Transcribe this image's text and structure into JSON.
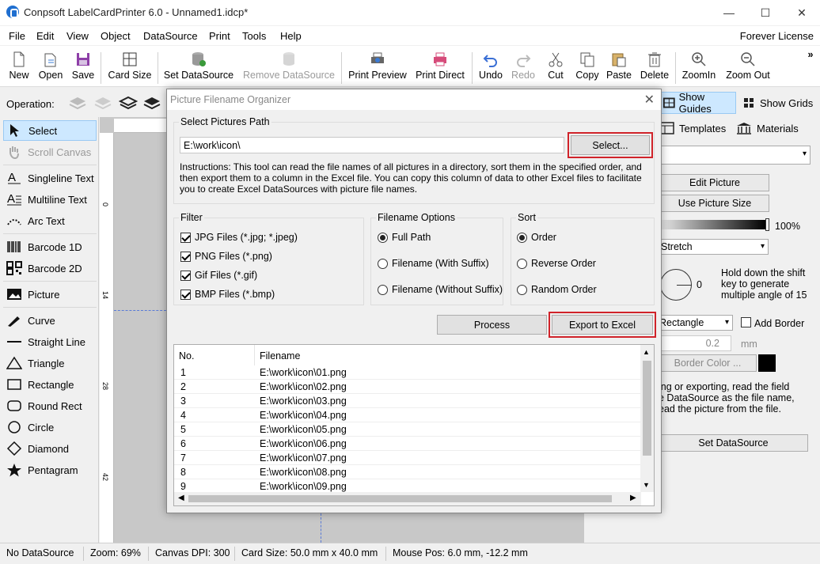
{
  "window": {
    "title": "Conpsoft LabelCardPrinter 6.0 - Unnamed1.idcp*",
    "minimize": "—",
    "maximize": "☐",
    "close": "✕"
  },
  "menu": {
    "items": [
      "File",
      "Edit",
      "View",
      "Object",
      "DataSource",
      "Print",
      "Tools",
      "Help"
    ],
    "license": "Forever License"
  },
  "toolbar": {
    "new": "New",
    "open": "Open",
    "save": "Save",
    "card_size": "Card Size",
    "set_datasource": "Set DataSource",
    "remove_datasource": "Remove DataSource",
    "print_preview": "Print Preview",
    "print_direct": "Print Direct",
    "undo": "Undo",
    "redo": "Redo",
    "cut": "Cut",
    "copy": "Copy",
    "paste": "Paste",
    "delete": "Delete",
    "zoom_in": "ZoomIn",
    "zoom_out": "Zoom Out",
    "more": "»"
  },
  "operation": {
    "label": "Operation:",
    "show_guides": "Show Guides",
    "show_grids": "Show Grids"
  },
  "left_tools": [
    "Select",
    "Scroll Canvas",
    "Singleline Text",
    "Multiline Text",
    "Arc Text",
    "Barcode 1D",
    "Barcode 2D",
    "Picture",
    "Curve",
    "Straight Line",
    "Triangle",
    "Rectangle",
    "Round Rect",
    "Circle",
    "Diamond",
    "Pentagram"
  ],
  "ruler": {
    "marks": [
      "0",
      "14",
      "28",
      "42"
    ]
  },
  "right_panel": {
    "tab_templates": "Templates",
    "tab_materials": "Materials",
    "edit_picture": "Edit Picture",
    "use_picture_size": "Use Picture Size",
    "opacity": "100%",
    "stretch": "Stretch",
    "angle_value": "0",
    "angle_hint": "Hold down the shift key to generate multiple angle of 15",
    "shape": "Rectangle",
    "add_border": "Add Border",
    "border_width": "0.2",
    "unit": "mm",
    "border_color": "Border Color ...",
    "ds_hint_1": "ing or exporting, read the field",
    "ds_hint_2": "e DataSource as the file name,",
    "ds_hint_3": "ead the picture from the file.",
    "set_datasource": "Set DataSource"
  },
  "status": {
    "ds": "No DataSource",
    "zoom": "Zoom: 69%",
    "dpi": "Canvas DPI: 300",
    "card": "Card Size: 50.0 mm x 40.0 mm",
    "mouse": "Mouse Pos: 6.0 mm, -12.2 mm"
  },
  "dialog": {
    "title": "Picture Filename Organizer",
    "path_group": "Select Pictures Path",
    "path_value": "E:\\work\\icon\\",
    "select_button": "Select...",
    "instructions": "Instructions: This tool can read the file names of all pictures in a directory, sort them in the specified order, and then export them to a column in the Excel file. You can copy this column of data to other Excel files to facilitate you to create Excel DataSources with picture file names.",
    "filter_group": "Filter",
    "filters": [
      "JPG Files (*.jpg; *.jpeg)",
      "PNG Files (*.png)",
      "Gif Files (*.gif)",
      "BMP Files (*.bmp)"
    ],
    "filename_group": "Filename Options",
    "filename_options": [
      "Full Path",
      "Filename (With Suffix)",
      "Filename (Without Suffix)"
    ],
    "sort_group": "Sort",
    "sort_options": [
      "Order",
      "Reverse Order",
      "Random Order"
    ],
    "process_button": "Process",
    "export_button": "Export to Excel",
    "columns": [
      "No.",
      "Filename"
    ],
    "rows": [
      [
        "1",
        "E:\\work\\icon\\01.png"
      ],
      [
        "2",
        "E:\\work\\icon\\02.png"
      ],
      [
        "3",
        "E:\\work\\icon\\03.png"
      ],
      [
        "4",
        "E:\\work\\icon\\04.png"
      ],
      [
        "5",
        "E:\\work\\icon\\05.png"
      ],
      [
        "6",
        "E:\\work\\icon\\06.png"
      ],
      [
        "7",
        "E:\\work\\icon\\07.png"
      ],
      [
        "8",
        "E:\\work\\icon\\08.png"
      ],
      [
        "9",
        "E:\\work\\icon\\09.png"
      ]
    ]
  }
}
